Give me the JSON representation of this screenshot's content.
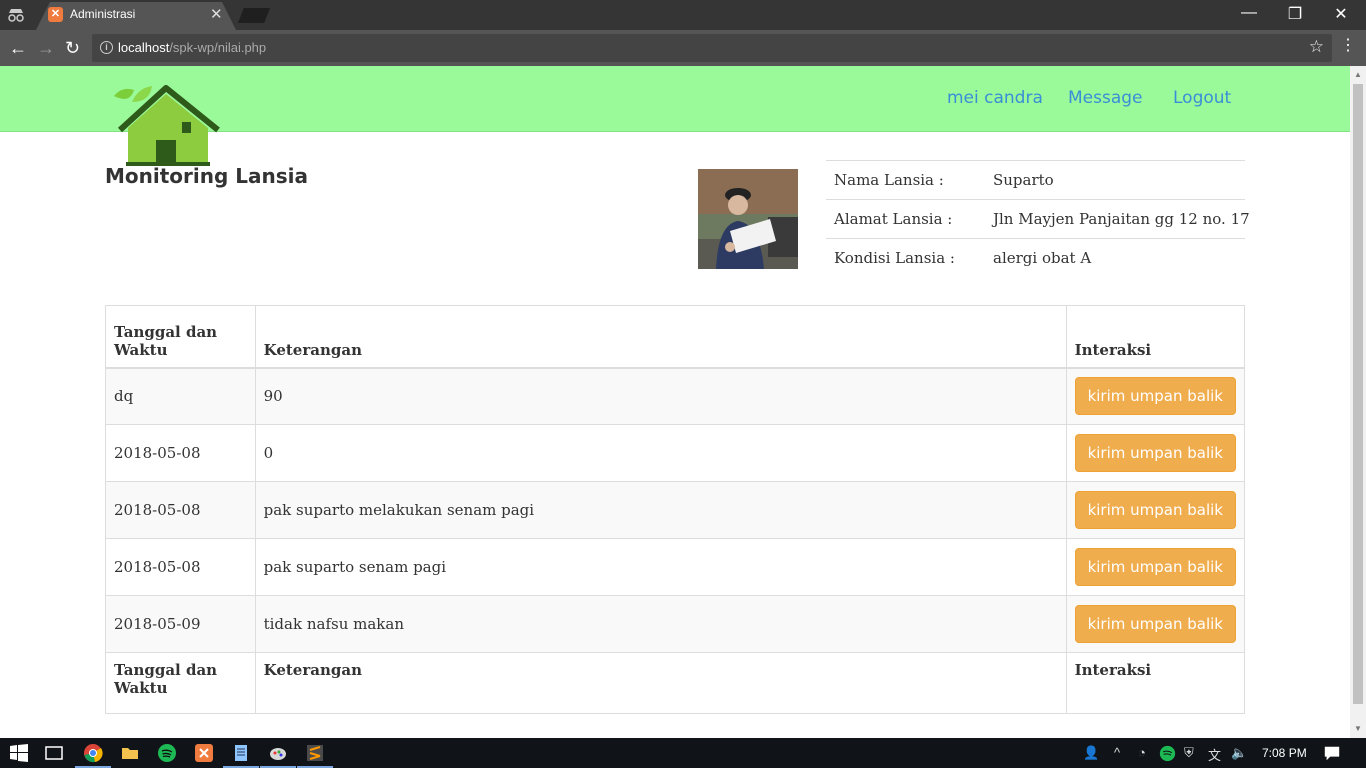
{
  "browser": {
    "tab_title": "Administrasi",
    "url_host": "localhost",
    "url_path": "/spk-wp/nilai.php"
  },
  "nav": {
    "links": [
      "mei candra",
      "Message",
      "Logout"
    ]
  },
  "brand": {
    "title": "Monitoring Lansia"
  },
  "profile": {
    "rows": [
      {
        "label": "Nama Lansia :",
        "value": "Suparto"
      },
      {
        "label": "Alamat Lansia :",
        "value": "Jln Mayjen Panjaitan gg 12 no. 17"
      },
      {
        "label": "Kondisi Lansia :",
        "value": "alergi obat A"
      }
    ]
  },
  "table": {
    "headers": [
      "Tanggal dan Waktu",
      "Keterangan",
      "Interaksi"
    ],
    "button_label": "kirim umpan balik",
    "rows": [
      {
        "date": "dq",
        "ket": "90"
      },
      {
        "date": "2018-05-08",
        "ket": "0"
      },
      {
        "date": "2018-05-08",
        "ket": "pak suparto melakukan senam pagi"
      },
      {
        "date": "2018-05-08",
        "ket": "pak suparto senam pagi"
      },
      {
        "date": "2018-05-09",
        "ket": "tidak nafsu makan"
      }
    ]
  },
  "taskbar": {
    "clock": "7:08 PM"
  },
  "colors": {
    "navbar": "#9afa9a",
    "nav_link": "#3a8ed6",
    "button": "#f0ad4e"
  }
}
